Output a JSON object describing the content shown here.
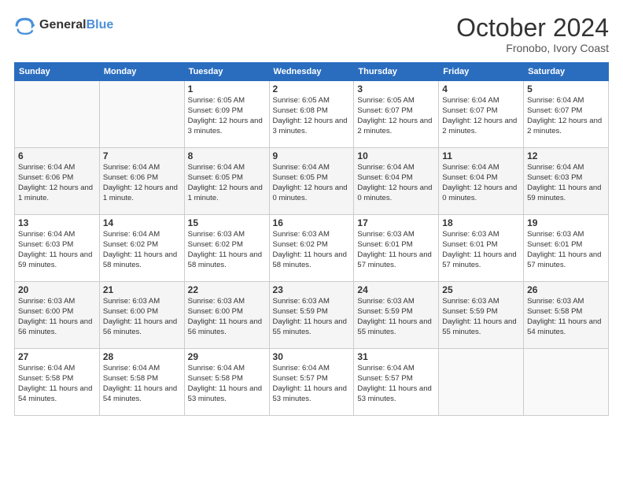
{
  "logo": {
    "line1": "General",
    "line2": "Blue"
  },
  "title": "October 2024",
  "subtitle": "Fronobo, Ivory Coast",
  "headers": [
    "Sunday",
    "Monday",
    "Tuesday",
    "Wednesday",
    "Thursday",
    "Friday",
    "Saturday"
  ],
  "weeks": [
    [
      {
        "day": "",
        "info": ""
      },
      {
        "day": "",
        "info": ""
      },
      {
        "day": "1",
        "info": "Sunrise: 6:05 AM\nSunset: 6:09 PM\nDaylight: 12 hours and 3 minutes."
      },
      {
        "day": "2",
        "info": "Sunrise: 6:05 AM\nSunset: 6:08 PM\nDaylight: 12 hours and 3 minutes."
      },
      {
        "day": "3",
        "info": "Sunrise: 6:05 AM\nSunset: 6:07 PM\nDaylight: 12 hours and 2 minutes."
      },
      {
        "day": "4",
        "info": "Sunrise: 6:04 AM\nSunset: 6:07 PM\nDaylight: 12 hours and 2 minutes."
      },
      {
        "day": "5",
        "info": "Sunrise: 6:04 AM\nSunset: 6:07 PM\nDaylight: 12 hours and 2 minutes."
      }
    ],
    [
      {
        "day": "6",
        "info": "Sunrise: 6:04 AM\nSunset: 6:06 PM\nDaylight: 12 hours and 1 minute."
      },
      {
        "day": "7",
        "info": "Sunrise: 6:04 AM\nSunset: 6:06 PM\nDaylight: 12 hours and 1 minute."
      },
      {
        "day": "8",
        "info": "Sunrise: 6:04 AM\nSunset: 6:05 PM\nDaylight: 12 hours and 1 minute."
      },
      {
        "day": "9",
        "info": "Sunrise: 6:04 AM\nSunset: 6:05 PM\nDaylight: 12 hours and 0 minutes."
      },
      {
        "day": "10",
        "info": "Sunrise: 6:04 AM\nSunset: 6:04 PM\nDaylight: 12 hours and 0 minutes."
      },
      {
        "day": "11",
        "info": "Sunrise: 6:04 AM\nSunset: 6:04 PM\nDaylight: 12 hours and 0 minutes."
      },
      {
        "day": "12",
        "info": "Sunrise: 6:04 AM\nSunset: 6:03 PM\nDaylight: 11 hours and 59 minutes."
      }
    ],
    [
      {
        "day": "13",
        "info": "Sunrise: 6:04 AM\nSunset: 6:03 PM\nDaylight: 11 hours and 59 minutes."
      },
      {
        "day": "14",
        "info": "Sunrise: 6:04 AM\nSunset: 6:02 PM\nDaylight: 11 hours and 58 minutes."
      },
      {
        "day": "15",
        "info": "Sunrise: 6:03 AM\nSunset: 6:02 PM\nDaylight: 11 hours and 58 minutes."
      },
      {
        "day": "16",
        "info": "Sunrise: 6:03 AM\nSunset: 6:02 PM\nDaylight: 11 hours and 58 minutes."
      },
      {
        "day": "17",
        "info": "Sunrise: 6:03 AM\nSunset: 6:01 PM\nDaylight: 11 hours and 57 minutes."
      },
      {
        "day": "18",
        "info": "Sunrise: 6:03 AM\nSunset: 6:01 PM\nDaylight: 11 hours and 57 minutes."
      },
      {
        "day": "19",
        "info": "Sunrise: 6:03 AM\nSunset: 6:01 PM\nDaylight: 11 hours and 57 minutes."
      }
    ],
    [
      {
        "day": "20",
        "info": "Sunrise: 6:03 AM\nSunset: 6:00 PM\nDaylight: 11 hours and 56 minutes."
      },
      {
        "day": "21",
        "info": "Sunrise: 6:03 AM\nSunset: 6:00 PM\nDaylight: 11 hours and 56 minutes."
      },
      {
        "day": "22",
        "info": "Sunrise: 6:03 AM\nSunset: 6:00 PM\nDaylight: 11 hours and 56 minutes."
      },
      {
        "day": "23",
        "info": "Sunrise: 6:03 AM\nSunset: 5:59 PM\nDaylight: 11 hours and 55 minutes."
      },
      {
        "day": "24",
        "info": "Sunrise: 6:03 AM\nSunset: 5:59 PM\nDaylight: 11 hours and 55 minutes."
      },
      {
        "day": "25",
        "info": "Sunrise: 6:03 AM\nSunset: 5:59 PM\nDaylight: 11 hours and 55 minutes."
      },
      {
        "day": "26",
        "info": "Sunrise: 6:03 AM\nSunset: 5:58 PM\nDaylight: 11 hours and 54 minutes."
      }
    ],
    [
      {
        "day": "27",
        "info": "Sunrise: 6:04 AM\nSunset: 5:58 PM\nDaylight: 11 hours and 54 minutes."
      },
      {
        "day": "28",
        "info": "Sunrise: 6:04 AM\nSunset: 5:58 PM\nDaylight: 11 hours and 54 minutes."
      },
      {
        "day": "29",
        "info": "Sunrise: 6:04 AM\nSunset: 5:58 PM\nDaylight: 11 hours and 53 minutes."
      },
      {
        "day": "30",
        "info": "Sunrise: 6:04 AM\nSunset: 5:57 PM\nDaylight: 11 hours and 53 minutes."
      },
      {
        "day": "31",
        "info": "Sunrise: 6:04 AM\nSunset: 5:57 PM\nDaylight: 11 hours and 53 minutes."
      },
      {
        "day": "",
        "info": ""
      },
      {
        "day": "",
        "info": ""
      }
    ]
  ]
}
